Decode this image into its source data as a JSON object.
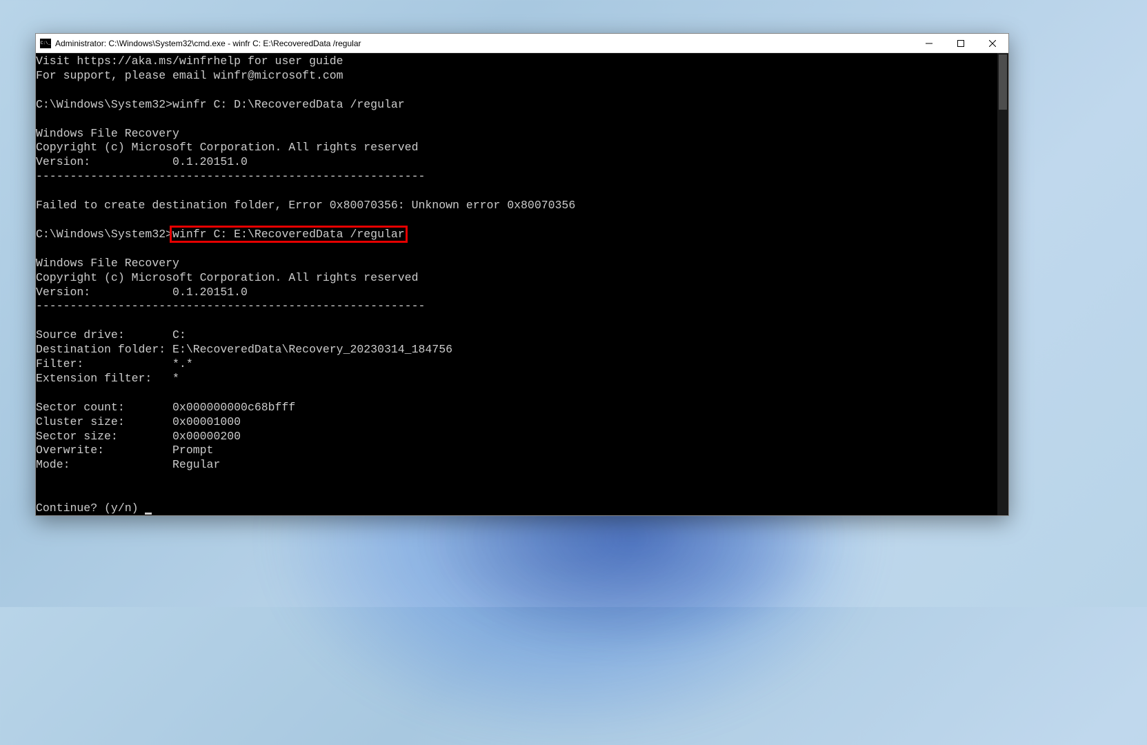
{
  "window": {
    "title": "Administrator: C:\\Windows\\System32\\cmd.exe - winfr  C: E:\\RecoveredData /regular"
  },
  "terminal": {
    "lines": [
      "Visit https://aka.ms/winfrhelp for user guide",
      "For support, please email winfr@microsoft.com",
      "",
      "C:\\Windows\\System32>winfr C: D:\\RecoveredData /regular",
      "",
      "Windows File Recovery",
      "Copyright (c) Microsoft Corporation. All rights reserved",
      "Version:            0.1.20151.0",
      "---------------------------------------------------------",
      "",
      "Failed to create destination folder, Error 0x80070356: Unknown error 0x80070356",
      "",
      "C:\\Windows\\System32>winfr C: E:\\RecoveredData /regular",
      "",
      "Windows File Recovery",
      "Copyright (c) Microsoft Corporation. All rights reserved",
      "Version:            0.1.20151.0",
      "---------------------------------------------------------",
      "",
      "Source drive:       C:",
      "Destination folder: E:\\RecoveredData\\Recovery_20230314_184756",
      "Filter:             *.*",
      "Extension filter:   *",
      "",
      "Sector count:       0x000000000c68bfff",
      "Cluster size:       0x00001000",
      "Sector size:        0x00000200",
      "Overwrite:          Prompt",
      "Mode:               Regular",
      "",
      "",
      "Continue? (y/n) "
    ],
    "highlighted_command": "winfr C: E:\\RecoveredData /regular",
    "prompt_prefix": "C:\\Windows\\System32>"
  }
}
